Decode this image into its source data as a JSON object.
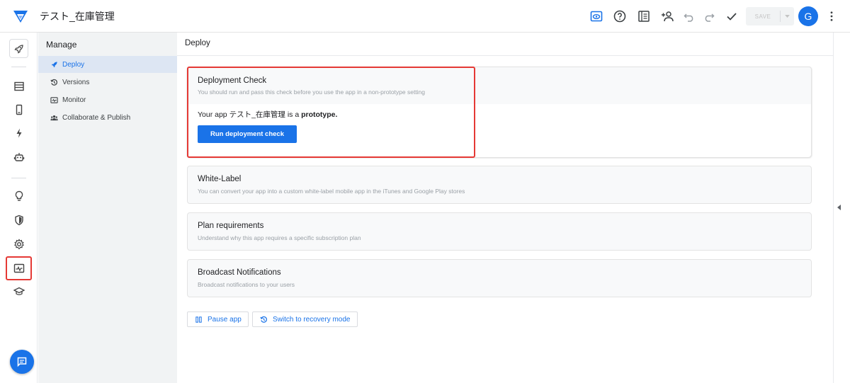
{
  "app": {
    "title": "テスト_在庫管理"
  },
  "toolbar": {
    "save_label": "SAVE",
    "avatar_initial": "G",
    "icons": [
      "preview-icon",
      "help-icon",
      "docs-icon",
      "add-person-icon",
      "undo-icon",
      "redo-icon",
      "check-icon",
      "more-vert-icon"
    ]
  },
  "rail": {
    "icons": [
      "rocket-icon",
      "table-icon",
      "phone-icon",
      "bolt-icon",
      "robot-icon",
      "lightbulb-icon",
      "shield-icon",
      "gear-icon",
      "monitor-icon",
      "graduation-cap-icon",
      "chat-icon"
    ],
    "active": "monitor-icon"
  },
  "manage": {
    "title": "Manage",
    "items": [
      {
        "label": "Deploy",
        "icon": "rocket-icon",
        "active": true
      },
      {
        "label": "Versions",
        "icon": "history-icon",
        "active": false
      },
      {
        "label": "Monitor",
        "icon": "monitor-icon",
        "active": false
      },
      {
        "label": "Collaborate & Publish",
        "icon": "people-icon",
        "active": false
      }
    ]
  },
  "main": {
    "title": "Deploy",
    "deployment_check": {
      "title": "Deployment Check",
      "subtitle": "You should run and pass this check before you use the app in a non-prototype setting",
      "text_prefix": "Your app テスト_在庫管理 is a ",
      "text_bold": "prototype.",
      "button_label": "Run deployment check"
    },
    "cards": [
      {
        "title": "White-Label",
        "subtitle": "You can convert your app into a custom white-label mobile app in the iTunes and Google Play stores"
      },
      {
        "title": "Plan requirements",
        "subtitle": "Understand why this app requires a specific subscription plan"
      },
      {
        "title": "Broadcast Notifications",
        "subtitle": "Broadcast notifications to your users"
      }
    ],
    "actions": {
      "pause_label": "Pause app",
      "recovery_label": "Switch to recovery mode"
    }
  },
  "colors": {
    "accent": "#1a73e8",
    "highlight": "#e53935",
    "panel": "#f1f3f4"
  }
}
